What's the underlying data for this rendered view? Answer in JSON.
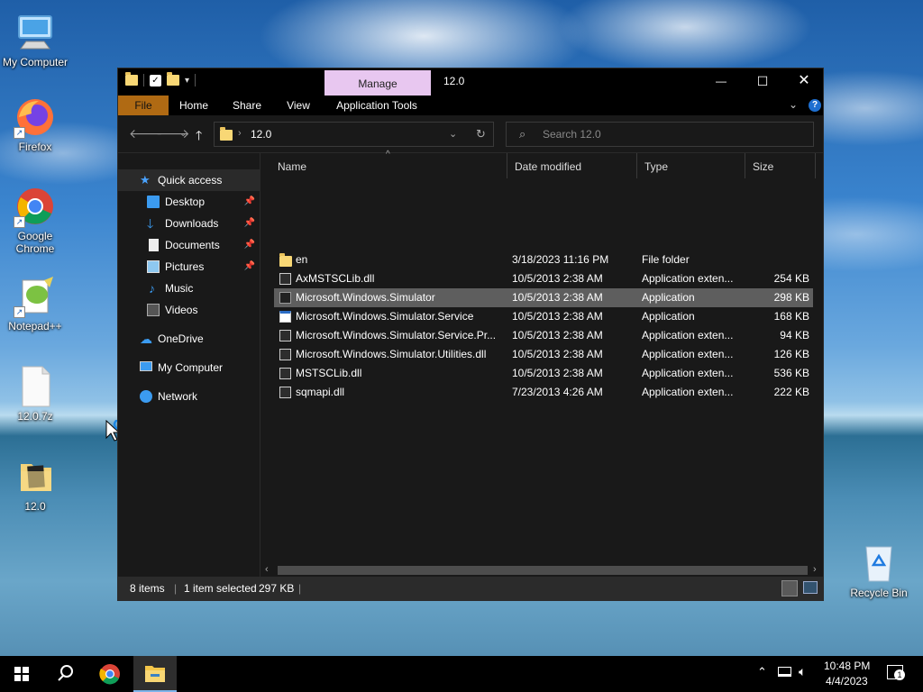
{
  "desktop": {
    "icons": [
      {
        "label": "My Computer",
        "icon": "computer-icon"
      },
      {
        "label": "Firefox",
        "icon": "firefox-icon"
      },
      {
        "label": "Google Chrome",
        "icon": "chrome-icon"
      },
      {
        "label": "Notepad++",
        "icon": "notepadpp-icon"
      },
      {
        "label": "12.0.7z",
        "icon": "archive-file-icon"
      },
      {
        "label": "12.0",
        "icon": "folder-icon"
      },
      {
        "label": "Recycle Bin",
        "icon": "recycle-bin-icon"
      }
    ]
  },
  "window": {
    "title": "12.0",
    "manage_tab": "Manage",
    "ribbon_tabs": [
      "File",
      "Home",
      "Share",
      "View",
      "Application Tools"
    ],
    "controls": {
      "minimize": "—",
      "maximize": "☐",
      "close": "✕"
    },
    "address": {
      "path": "12.0"
    },
    "search": {
      "placeholder": "Search 12.0"
    },
    "nav": {
      "quick_access": "Quick access",
      "items": [
        {
          "label": "Desktop",
          "pinned": true
        },
        {
          "label": "Downloads",
          "pinned": true
        },
        {
          "label": "Documents",
          "pinned": true
        },
        {
          "label": "Pictures",
          "pinned": true
        },
        {
          "label": "Music",
          "pinned": false
        },
        {
          "label": "Videos",
          "pinned": false
        }
      ],
      "onedrive": "OneDrive",
      "my_computer": "My Computer",
      "network": "Network"
    },
    "columns": {
      "name": "Name",
      "date": "Date modified",
      "type": "Type",
      "size": "Size"
    },
    "files": [
      {
        "name": "en",
        "date": "3/18/2023 11:16 PM",
        "type": "File folder",
        "size": ""
      },
      {
        "name": "AxMSTSCLib.dll",
        "date": "10/5/2013 2:38 AM",
        "type": "Application exten...",
        "size": "254 KB"
      },
      {
        "name": "Microsoft.Windows.Simulator",
        "date": "10/5/2013 2:38 AM",
        "type": "Application",
        "size": "298 KB"
      },
      {
        "name": "Microsoft.Windows.Simulator.Service",
        "date": "10/5/2013 2:38 AM",
        "type": "Application",
        "size": "168 KB"
      },
      {
        "name": "Microsoft.Windows.Simulator.Service.Pr...",
        "date": "10/5/2013 2:38 AM",
        "type": "Application exten...",
        "size": "94 KB"
      },
      {
        "name": "Microsoft.Windows.Simulator.Utilities.dll",
        "date": "10/5/2013 2:38 AM",
        "type": "Application exten...",
        "size": "126 KB"
      },
      {
        "name": "MSTSCLib.dll",
        "date": "10/5/2013 2:38 AM",
        "type": "Application exten...",
        "size": "536 KB"
      },
      {
        "name": "sqmapi.dll",
        "date": "7/23/2013 4:26 AM",
        "type": "Application exten...",
        "size": "222 KB"
      }
    ],
    "selected_index": 2,
    "status": {
      "count": "8 items",
      "selection": "1 item selected",
      "size": "297 KB"
    }
  },
  "taskbar": {
    "time": "10:48 PM",
    "date": "4/4/2023",
    "notifications": "1"
  },
  "colors": {
    "manage_tab": "#e8c7f0",
    "file_tab": "#b06a13",
    "selection": "#5e5e5e",
    "window_bg": "#191919"
  }
}
